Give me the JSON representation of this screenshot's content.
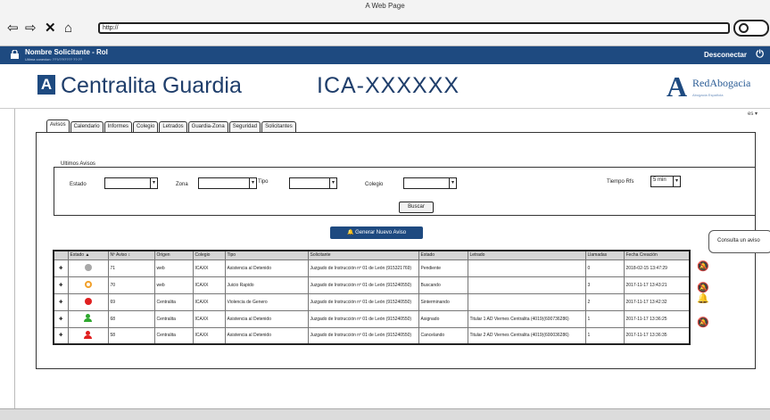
{
  "browser": {
    "title": "A Web Page",
    "url": "http://"
  },
  "header": {
    "user": "Nombre Solicitante - Rol",
    "user_sub": "Ultima conexion: ???/??/???? ??:??",
    "logout": "Desconectar",
    "app_name": "Centralita Guardia",
    "code": "ICA-XXXXXX",
    "brand_name": "RedAbogacia",
    "brand_sub": "Abogacia Española",
    "lang": "es ▾"
  },
  "tabs": [
    "Avisos",
    "Calendario",
    "Informes",
    "Colegio",
    "Letrados",
    "Guardia-Zona",
    "Seguridad",
    "Solicitantes"
  ],
  "filters": {
    "legend": "Ultimos Avisos",
    "estado_label": "Estado",
    "zona_label": "Zona",
    "tipo_label": "Tipo",
    "colegio_label": "Colegio",
    "tiempo_label": "Tiempo Rfs",
    "tiempo_value": "5 min",
    "search_button": "Buscar"
  },
  "new_button": "Generar Nuevo Aviso",
  "tooltip": "Consulta un aviso",
  "table": {
    "headers": [
      "",
      "Estado ▲",
      "Nº Aviso ↕",
      "Origen",
      "Colegio",
      "Tipo",
      "Solicitante",
      "Estado",
      "Letrado",
      "Llamadas",
      "Fecha Creación"
    ],
    "rows": [
      {
        "status_icon": "grey-dot",
        "aviso": "71",
        "origen": "web",
        "colegio": "ICAXX",
        "tipo": "Asistencia al Detenido",
        "solicitante": "Juzgado de Instrucción nº 01 de León (915321769)",
        "estado": "Pendiente",
        "letrado": "",
        "llamadas": "0",
        "fecha": "2018-02-15 13:47:29"
      },
      {
        "status_icon": "search-orange",
        "aviso": "70",
        "origen": "web",
        "colegio": "ICAXX",
        "tipo": "Juicio Rapido",
        "solicitante": "Juzgado de Instrucción nº 01 de León (915240550)",
        "estado": "Buscando",
        "letrado": "",
        "llamadas": "3",
        "fecha": "2017-11-17 13:43:21"
      },
      {
        "status_icon": "red-dot",
        "aviso": "69",
        "origen": "Centralita",
        "colegio": "ICAXX",
        "tipo": "Violencia de Genero",
        "solicitante": "Juzgado de Instrucción nº 01 de León (915240550)",
        "estado": "Sinterminando",
        "letrado": "",
        "llamadas": "2",
        "fecha": "2017-11-17 13:42:32"
      },
      {
        "status_icon": "green-person",
        "aviso": "68",
        "origen": "Centralita",
        "colegio": "ICAXX",
        "tipo": "Asistencia al Detenido",
        "solicitante": "Juzgado de Instrucción nº 01 de León (915240550)",
        "estado": "Asignado",
        "letrado": "Titular 1 AD Viernes Centralita (4019)(600736286)",
        "llamadas": "1",
        "fecha": "2017-11-17 13:36:25"
      },
      {
        "status_icon": "red-person",
        "aviso": "58",
        "origen": "Centralita",
        "colegio": "ICAXX",
        "tipo": "Asistencia al Detenido",
        "solicitante": "Juzgado de Instrucción nº 01 de León (915240550)",
        "estado": "Cancelando",
        "letrado": "Titular 2 AD Viernes Centralita (4019)(600036286)",
        "llamadas": "1",
        "fecha": "2017-11-17 13:36:35"
      }
    ]
  },
  "colors": {
    "header_blue": "#1e4a80",
    "accent_red": "#e02020",
    "accent_green": "#2fa82f",
    "accent_orange": "#f1a02b"
  }
}
